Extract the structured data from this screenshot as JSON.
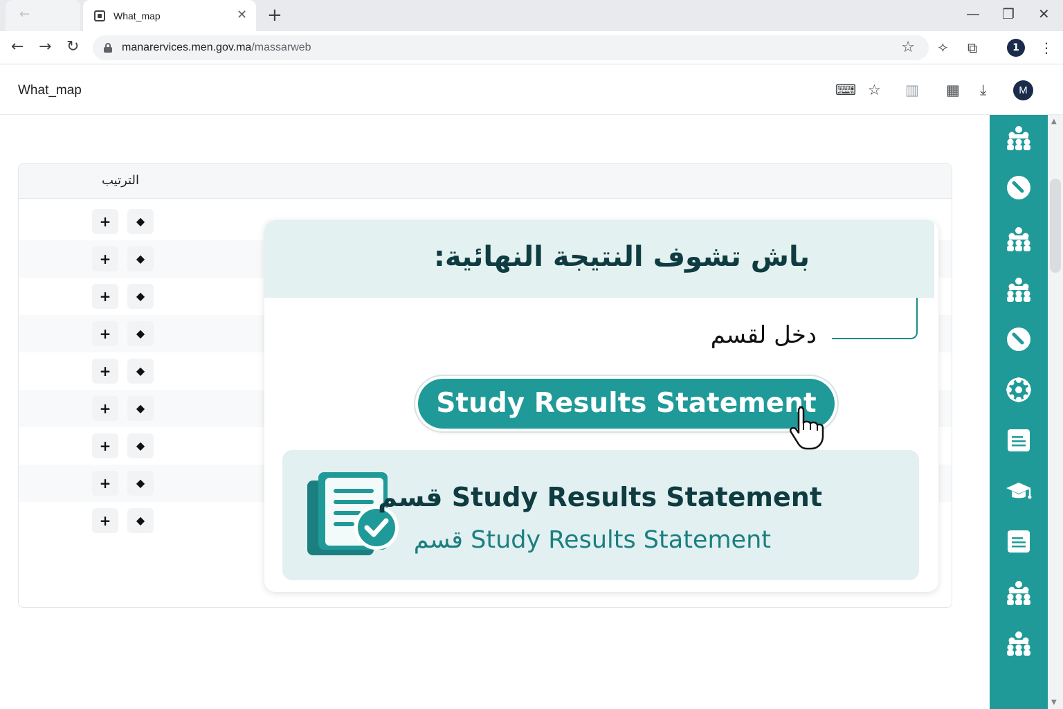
{
  "browser": {
    "tab_title": "What_map",
    "url_host": "manarervices.men.gov.ma",
    "url_path": "/massarweb",
    "profile_initial": "1"
  },
  "app": {
    "title": "What_map",
    "avatar_initial": "M"
  },
  "table": {
    "column_header": "الترتيب",
    "row_count": 9,
    "plus_label": "+",
    "diamond_label": "◆"
  },
  "overlay": {
    "heading": "باش تشوف النتيجة النهائية:",
    "enter_label": "دخل لقسم",
    "button_label": "Study Results Statement",
    "info_line1": "قسم Study Results Statement",
    "info_line2": "قسم Study Results Statement"
  },
  "sidebar": {
    "items": [
      "group-icon",
      "check-circle-icon",
      "group-icon",
      "group-icon",
      "check-circle-icon",
      "network-icon",
      "document-icon",
      "graduation-cap-icon",
      "document-icon",
      "group-icon",
      "group-icon"
    ]
  },
  "colors": {
    "accent": "#1f9a98",
    "heading": "#0e3c40",
    "panel": "#e3f0f1"
  }
}
